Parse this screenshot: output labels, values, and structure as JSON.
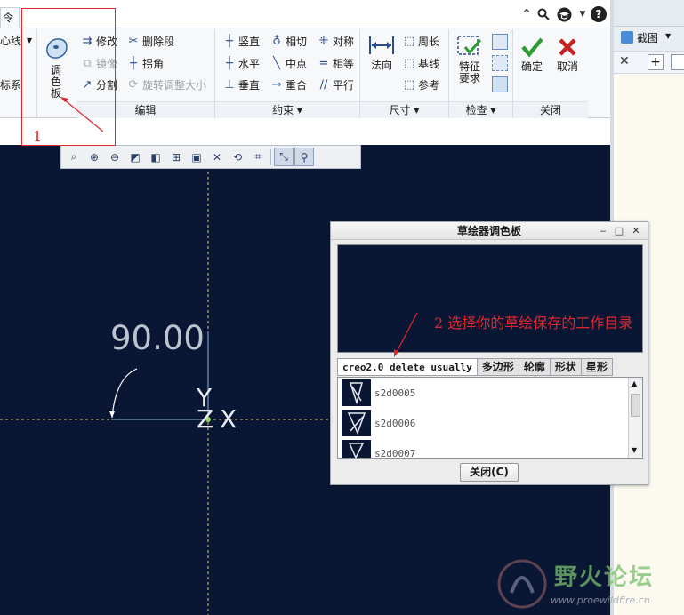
{
  "ribbon": {
    "tab_stub": "令",
    "left_cut_labels": [
      "心线",
      "标系"
    ],
    "palette_label": "调色板",
    "edit_group": {
      "label": "编辑",
      "modify": "修改",
      "mirror": "镜像",
      "split": "分割",
      "delete_segment": "删除段",
      "corner": "拐角",
      "rotate_resize": "旋转调整大小"
    },
    "constraint_group": {
      "label": "约束 ▾",
      "vertical": "竖直",
      "horizontal": "水平",
      "perpendicular": "垂直",
      "tangent": "相切",
      "midpoint": "中点",
      "coincident": "重合",
      "symmetric": "对称",
      "equal": "相等",
      "parallel": "平行"
    },
    "dimension_group": {
      "label": "尺寸 ▾",
      "normal": "法向",
      "perimeter": "周长",
      "baseline": "基线",
      "reference": "参考"
    },
    "inspect_group": {
      "label": "检查 ▾",
      "feature_requirements": "特征要求"
    },
    "close_group": {
      "label": "关闭",
      "ok": "确定",
      "cancel": "取消"
    }
  },
  "right_pane": {
    "screenshot": "截图"
  },
  "canvas": {
    "angle_dimension": "90.00",
    "axis_labels": [
      "Y",
      "Z",
      "X"
    ]
  },
  "palette_dialog": {
    "title": "草绘器调色板",
    "tabs": [
      "creo2.0 delete usually",
      "多边形",
      "轮廓",
      "形状",
      "星形"
    ],
    "items": [
      "s2d0005",
      "s2d0006",
      "s2d0007"
    ],
    "close_button": "关闭(C)"
  },
  "annotations": {
    "step1": "1",
    "step2": "2 选择你的草绘保存的工作目录"
  },
  "watermark": {
    "title": "野火论坛",
    "url": "www.proewildfire.cn"
  },
  "colors": {
    "canvas_bg": "#0a1734",
    "annotation_red": "#e0272b",
    "ok_green": "#2f9b33",
    "cancel_red": "#c82020"
  }
}
